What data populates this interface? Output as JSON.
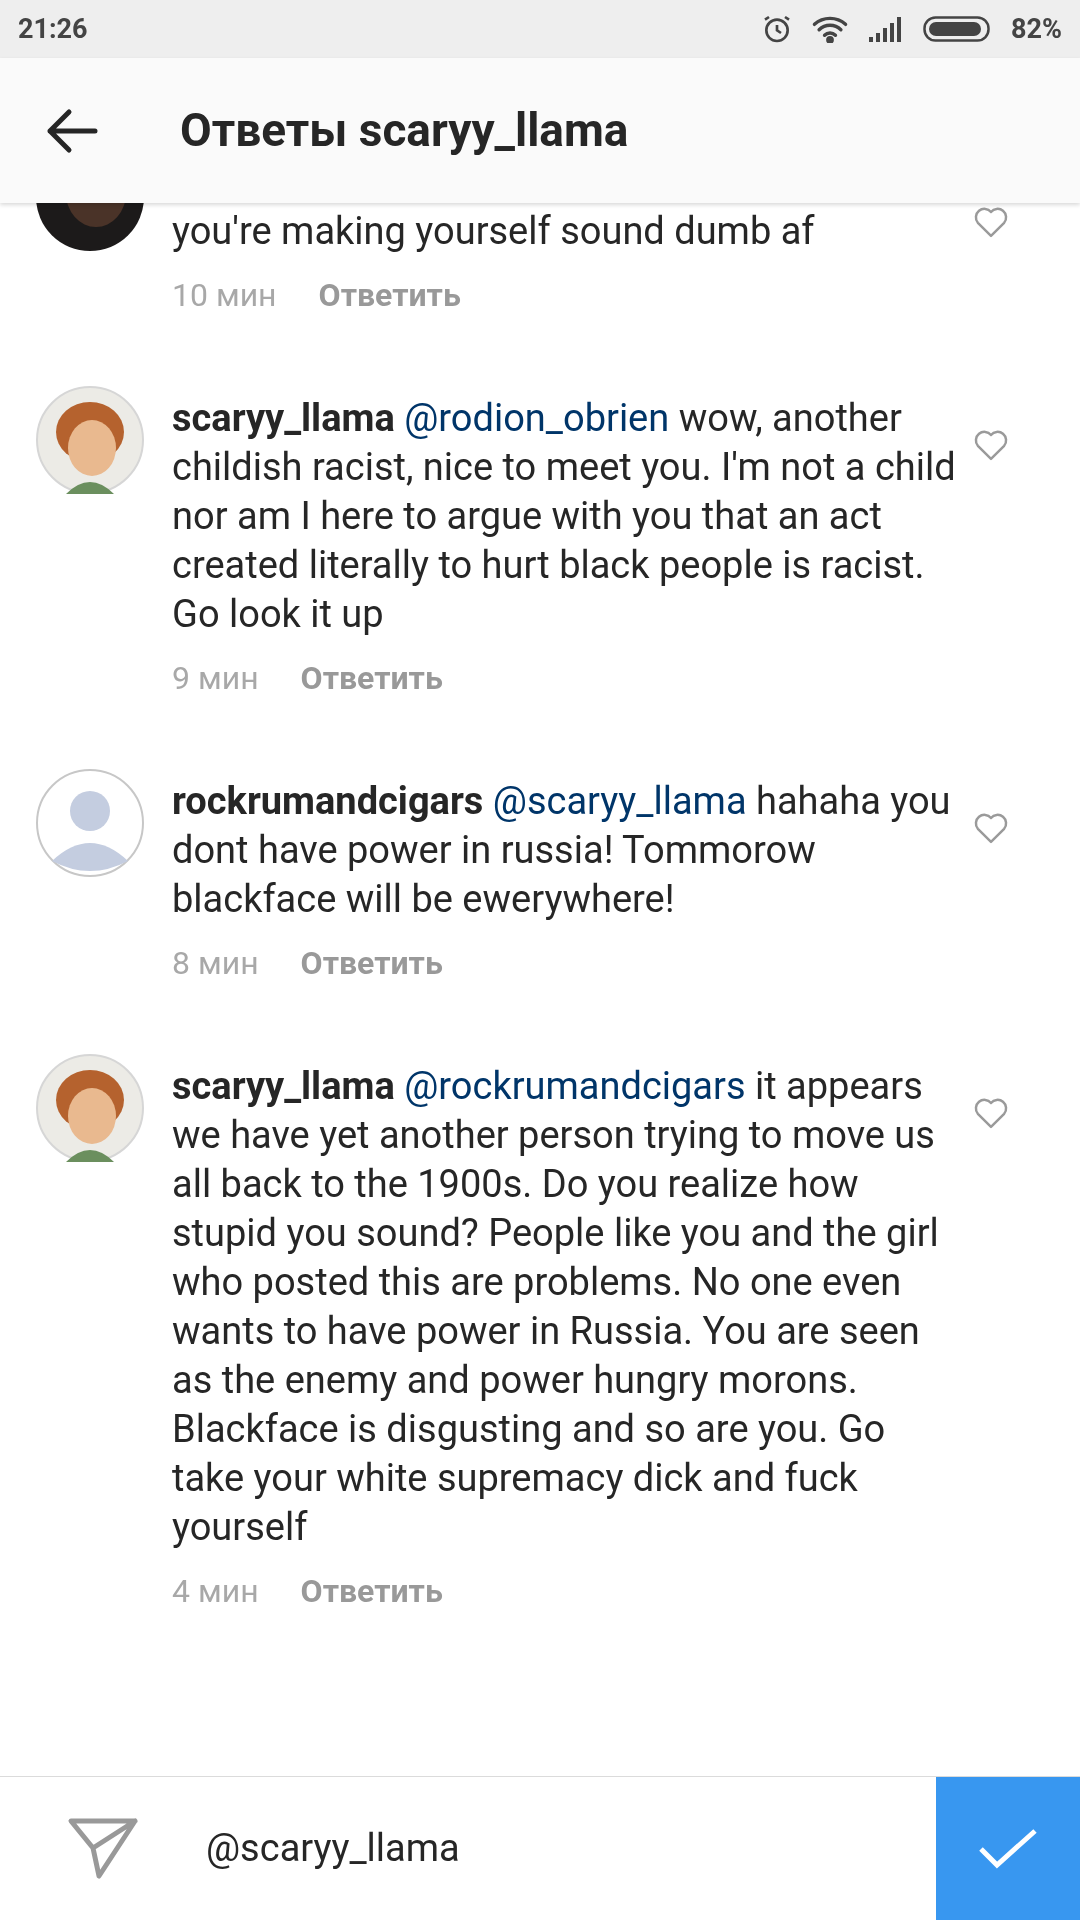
{
  "status_bar": {
    "time": "21:26",
    "battery": "82%"
  },
  "header": {
    "title": "Ответы scaryy_llama"
  },
  "comments": [
    {
      "avatar": {
        "kind": "dark"
      },
      "text": "you're making yourself sound dumb af",
      "time": "10 мин",
      "reply": "Ответить",
      "liked": false
    },
    {
      "avatar": {
        "kind": "drawing"
      },
      "username": "scaryy_llama",
      "mention": "@rodion_obrien",
      "text": "wow, another childish racist, nice to meet you. I'm not a child nor am I here to argue with you that an act created literally to hurt black people is racist. Go look it up",
      "time": "9 мин",
      "reply": "Ответить",
      "liked": false
    },
    {
      "avatar": {
        "kind": "default"
      },
      "username": "rockrumandcigars",
      "mention": "@scaryy_llama",
      "text": "hahaha you dont have power in russia! Tommorow blackface will be ewerywhere!",
      "time": "8 мин",
      "reply": "Ответить",
      "liked": false
    },
    {
      "avatar": {
        "kind": "drawing"
      },
      "username": "scaryy_llama",
      "mention": "@rockrumandcigars",
      "text": "it appears we have yet another person trying to move us all back to the 1900s. Do you realize how stupid you sound? People like you and the girl who posted this are problems. No one even wants to have power in Russia. You are seen as the enemy and power hungry morons. Blackface is disgusting and so are you. Go take your white supremacy dick and fuck yourself",
      "time": "4 мин",
      "reply": "Ответить",
      "liked": false
    }
  ],
  "composer": {
    "value": "@scaryy_llama"
  }
}
